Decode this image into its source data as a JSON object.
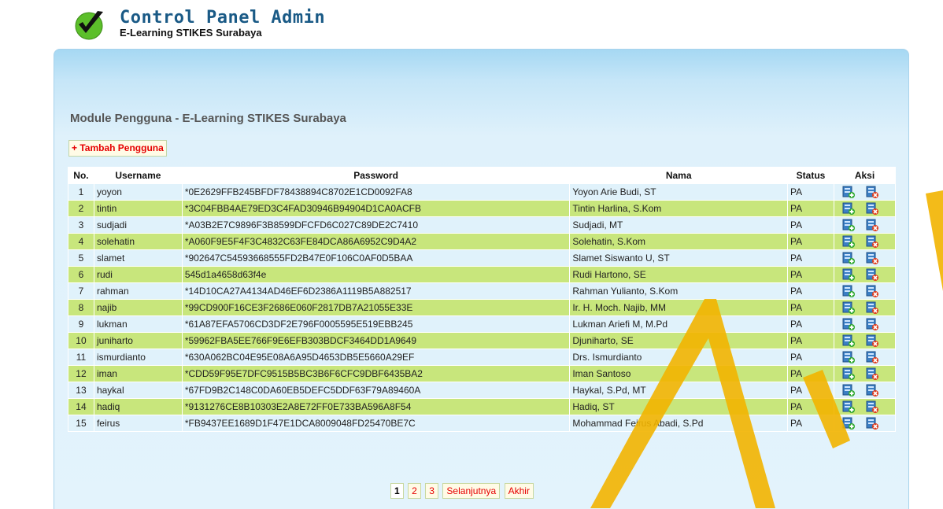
{
  "header": {
    "title": "Control Panel Admin",
    "subtitle": "E-Learning STIKES Surabaya",
    "logo_icon": "checkmark-icon"
  },
  "module": {
    "title": "Module Pengguna - E-Learning STIKES Surabaya",
    "add_button": "+ Tambah Pengguna"
  },
  "table": {
    "headers": [
      "No.",
      "Username",
      "Password",
      "Nama",
      "Status",
      "Aksi"
    ],
    "rows": [
      {
        "no": "1",
        "username": "yoyon",
        "password": "*0E2629FFB245BFDF78438894C8702E1CD0092FA8",
        "nama": "Yoyon Arie Budi, ST",
        "status": "PA"
      },
      {
        "no": "2",
        "username": "tintin",
        "password": "*3C04FBB4AE79ED3C4FAD30946B94904D1CA0ACFB",
        "nama": "Tintin Harlina, S.Kom",
        "status": "PA"
      },
      {
        "no": "3",
        "username": "sudjadi",
        "password": "*A03B2E7C9896F3B8599DFCFD6C027C89DE2C7410",
        "nama": "Sudjadi, MT",
        "status": "PA"
      },
      {
        "no": "4",
        "username": "solehatin",
        "password": "*A060F9E5F4F3C4832C63FE84DCA86A6952C9D4A2",
        "nama": "Solehatin, S.Kom",
        "status": "PA"
      },
      {
        "no": "5",
        "username": "slamet",
        "password": "*902647C54593668555FD2B47E0F106C0AF0D5BAA",
        "nama": "Slamet Siswanto U, ST",
        "status": "PA"
      },
      {
        "no": "6",
        "username": "rudi",
        "password": "545d1a4658d63f4e",
        "nama": "Rudi Hartono, SE",
        "status": "PA"
      },
      {
        "no": "7",
        "username": "rahman",
        "password": "*14D10CA27A4134AD46EF6D2386A1119B5A882517",
        "nama": "Rahman Yulianto, S.Kom",
        "status": "PA"
      },
      {
        "no": "8",
        "username": "najib",
        "password": "*99CD900F16CE3F2686E060F2817DB7A21055E33E",
        "nama": "Ir. H. Moch. Najib, MM",
        "status": "PA"
      },
      {
        "no": "9",
        "username": "lukman",
        "password": "*61A87EFA5706CD3DF2E796F0005595E519EBB245",
        "nama": "Lukman Ariefi M, M.Pd",
        "status": "PA"
      },
      {
        "no": "10",
        "username": "juniharto",
        "password": "*59962FBA5EE766F9E6EFB303BDCF3464DD1A9649",
        "nama": "Djuniharto, SE",
        "status": "PA"
      },
      {
        "no": "11",
        "username": "ismurdianto",
        "password": "*630A062BC04E95E08A6A95D4653DB5E5660A29EF",
        "nama": "Drs. Ismurdianto",
        "status": "PA"
      },
      {
        "no": "12",
        "username": "iman",
        "password": "*CDD59F95E7DFC9515B5BC3B6F6CFC9DBF6435BA2",
        "nama": "Iman Santoso",
        "status": "PA"
      },
      {
        "no": "13",
        "username": "haykal",
        "password": "*67FD9B2C148C0DA60EB5DEFC5DDF63F79A89460A",
        "nama": "Haykal, S.Pd, MT",
        "status": "PA"
      },
      {
        "no": "14",
        "username": "hadiq",
        "password": "*9131276CE8B10303E2A8E72FF0E733BA596A8F54",
        "nama": "Hadiq, ST",
        "status": "PA"
      },
      {
        "no": "15",
        "username": "feirus",
        "password": "*FB9437EE1689D1F47E1DCA8009048FD25470BE7C",
        "nama": "Mohammad Feirus Abadi, S.Pd",
        "status": "PA"
      }
    ],
    "edit_icon": "edit-icon",
    "delete_icon": "delete-icon"
  },
  "pagination": {
    "pages": [
      "1",
      "2",
      "3"
    ],
    "current": "1",
    "next": "Selanjutnya",
    "last": "Akhir"
  },
  "colors": {
    "row_odd": "#e0f2fb",
    "row_even": "#c8e67c",
    "accent_red": "#e60000",
    "title_blue": "#1a5a86"
  }
}
